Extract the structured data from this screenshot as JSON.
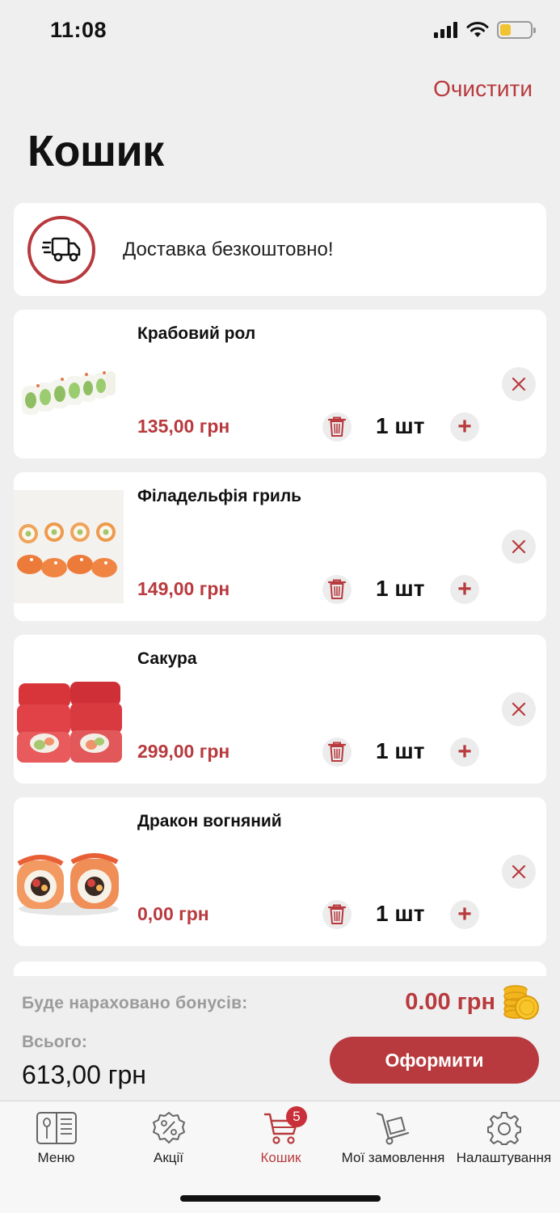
{
  "status_bar": {
    "time": "11:08",
    "battery_level": 0.35
  },
  "header": {
    "title": "Кошик",
    "clear_label": "Очистити"
  },
  "delivery": {
    "text": "Доставка безкоштовно!",
    "icon": "delivery-truck-icon"
  },
  "cart_items": [
    {
      "name": "Крабовий рол",
      "price": "135,00 грн",
      "quantity": "1 шт"
    },
    {
      "name": "Філадельфія гриль",
      "price": "149,00 грн",
      "quantity": "1 шт"
    },
    {
      "name": "Сакура",
      "price": "299,00 грн",
      "quantity": "1 шт"
    },
    {
      "name": "Дракон вогняний",
      "price": "0,00 грн",
      "quantity": "1 шт"
    }
  ],
  "summary": {
    "bonus_label": "Буде нараховано бонусів:",
    "bonus_value": "0.00 грн",
    "total_label": "Всього:",
    "total_value": "613,00 грн",
    "checkout_label": "Оформити"
  },
  "tabbar": {
    "tabs": [
      {
        "label": "Меню",
        "icon": "menu-book-icon"
      },
      {
        "label": "Акції",
        "icon": "percent-badge-icon"
      },
      {
        "label": "Кошик",
        "icon": "cart-icon",
        "badge": "5",
        "active": true
      },
      {
        "label": "Мої замовлення",
        "icon": "hand-truck-icon"
      },
      {
        "label": "Налаштування",
        "icon": "gear-icon"
      }
    ]
  },
  "colors": {
    "accent": "#b83a3e",
    "background": "#efefef",
    "card": "#ffffff",
    "muted": "#9b9b9b"
  }
}
